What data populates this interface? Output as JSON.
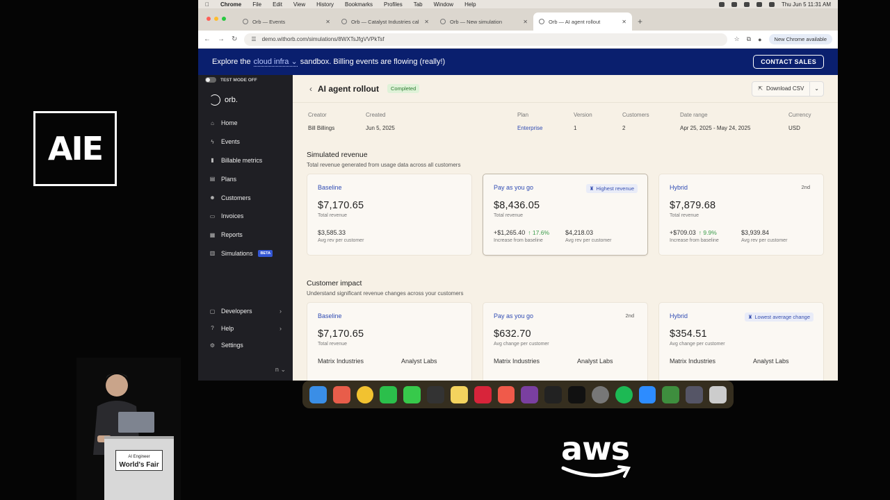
{
  "overlay": {
    "conference_logo": "AIE",
    "sponsor_logo": "aws",
    "podium_title": "World's Fair",
    "podium_subtitle": "AI Engineer"
  },
  "menubar": {
    "app": "Chrome",
    "items": [
      "File",
      "Edit",
      "View",
      "History",
      "Bookmarks",
      "Profiles",
      "Tab",
      "Window",
      "Help"
    ],
    "datetime": "Thu Jun 5  11:31 AM"
  },
  "tabs": [
    {
      "label": "Orb — Events"
    },
    {
      "label": "Orb — Catalyst Industries cal"
    },
    {
      "label": "Orb — New simulation"
    },
    {
      "label": "Orb — AI agent rollout"
    }
  ],
  "address": {
    "url": "demo.withorb.com/simulations/8WXTsJfgVVPkTsf",
    "update_label": "New Chrome available"
  },
  "banner": {
    "prefix": "Explore the",
    "sandbox": "cloud infra",
    "suffix": "sandbox. Billing events are flowing (really!)",
    "cta": "CONTACT SALES"
  },
  "sidebar": {
    "test_mode": "TEST MODE OFF",
    "brand": "orb.",
    "items": [
      {
        "label": "Home",
        "icon": "home-icon"
      },
      {
        "label": "Events",
        "icon": "bolt-icon"
      },
      {
        "label": "Billable metrics",
        "icon": "metrics-icon"
      },
      {
        "label": "Plans",
        "icon": "plans-icon"
      },
      {
        "label": "Customers",
        "icon": "customers-icon"
      },
      {
        "label": "Invoices",
        "icon": "invoices-icon"
      },
      {
        "label": "Reports",
        "icon": "reports-icon"
      },
      {
        "label": "Simulations",
        "icon": "simulations-icon",
        "badge": "BETA"
      }
    ],
    "bottom": [
      {
        "label": "Developers"
      },
      {
        "label": "Help"
      },
      {
        "label": "Settings"
      }
    ],
    "footer_partial": "n"
  },
  "page": {
    "title": "AI agent rollout",
    "status": "Completed",
    "download": "Download CSV",
    "meta": [
      {
        "label": "Creator",
        "value": "Bill Billings"
      },
      {
        "label": "Created",
        "value": "Jun 5, 2025"
      },
      {
        "label": "Plan",
        "value": "Enterprise"
      },
      {
        "label": "Version",
        "value": "1"
      },
      {
        "label": "Customers",
        "value": "2"
      },
      {
        "label": "Date range",
        "value": "Apr 25, 2025 - May 24, 2025"
      },
      {
        "label": "Currency",
        "value": "USD"
      }
    ]
  },
  "revenue": {
    "title": "Simulated revenue",
    "subtitle": "Total revenue generated from usage data across all customers",
    "cards": [
      {
        "name": "Baseline",
        "value": "$7,170.65",
        "value_label": "Total revenue",
        "cells": [
          {
            "value": "$3,585.33",
            "label": "Avg rev per customer"
          }
        ]
      },
      {
        "name": "Pay as you go",
        "value": "$8,436.05",
        "value_label": "Total revenue",
        "badge": "Highest revenue",
        "cells": [
          {
            "value": "+$1,265.40",
            "delta": "↑ 17.6%",
            "label": "Increase from baseline"
          },
          {
            "value": "$4,218.03",
            "label": "Avg rev per customer"
          }
        ]
      },
      {
        "name": "Hybrid",
        "value": "$7,879.68",
        "value_label": "Total revenue",
        "badge": "2nd",
        "cells": [
          {
            "value": "+$709.03",
            "delta": "↑ 9.9%",
            "label": "Increase from baseline"
          },
          {
            "value": "$3,939.84",
            "label": "Avg rev per customer"
          }
        ]
      }
    ]
  },
  "impact": {
    "title": "Customer impact",
    "subtitle": "Understand significant revenue changes across your customers",
    "cards": [
      {
        "name": "Baseline",
        "value": "$7,170.65",
        "value_label": "Total revenue",
        "companies": [
          "Matrix Industries",
          "Analyst Labs"
        ]
      },
      {
        "name": "Pay as you go",
        "value": "$632.70",
        "value_label": "Avg change per customer",
        "badge": "2nd",
        "companies": [
          "Matrix Industries",
          "Analyst Labs"
        ]
      },
      {
        "name": "Hybrid",
        "value": "$354.51",
        "value_label": "Avg change per customer",
        "badge": "Lowest average change",
        "companies": [
          "Matrix Industries",
          "Analyst Labs"
        ]
      }
    ]
  },
  "colors": {
    "banner": "#0a1f6e",
    "sidebar": "#1f1f24",
    "background": "#f7f1e6",
    "link": "#2f4bb3",
    "positive": "#3a9c4a"
  }
}
